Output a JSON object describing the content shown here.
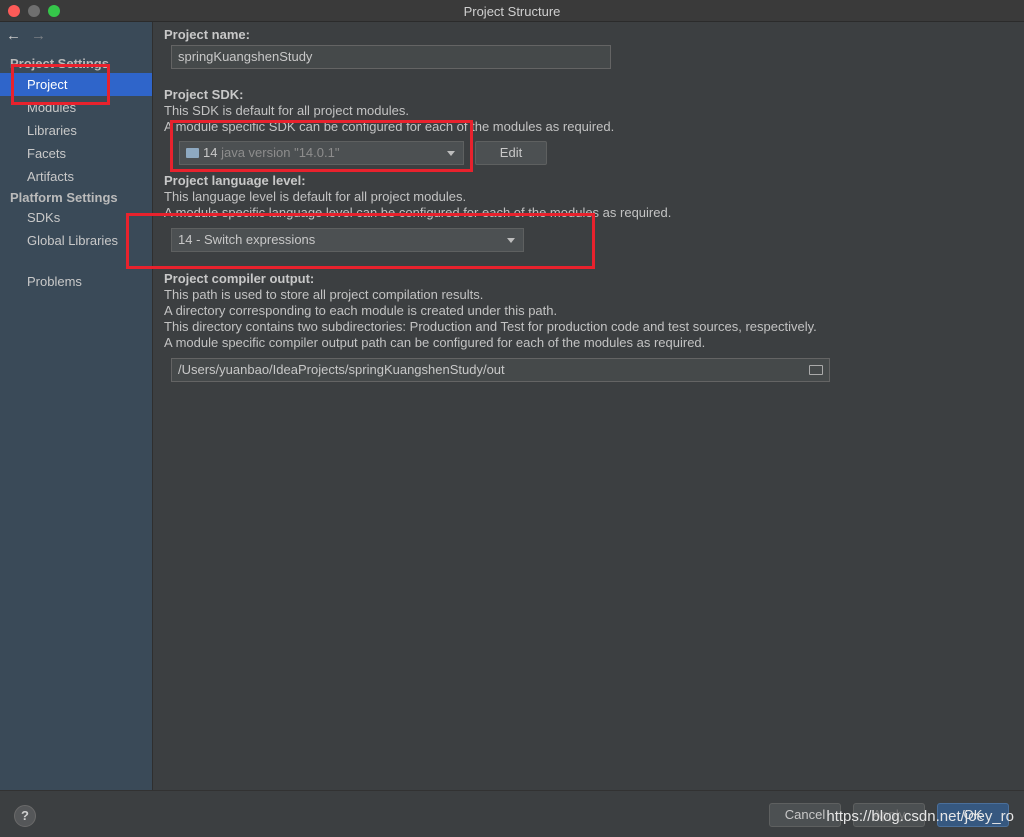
{
  "window": {
    "title": "Project Structure"
  },
  "nav": {
    "back": "←",
    "forward": "→"
  },
  "sidebar": {
    "project_settings_header": "Project Settings",
    "items": [
      {
        "label": "Project"
      },
      {
        "label": "Modules"
      },
      {
        "label": "Libraries"
      },
      {
        "label": "Facets"
      },
      {
        "label": "Artifacts"
      }
    ],
    "platform_settings_header": "Platform Settings",
    "platform_items": [
      {
        "label": "SDKs"
      },
      {
        "label": "Global Libraries"
      }
    ],
    "problems_label": "Problems"
  },
  "project_name": {
    "label": "Project name:",
    "value": "springKuangshenStudy"
  },
  "project_sdk": {
    "label": "Project SDK:",
    "desc1": "This SDK is default for all project modules.",
    "desc2": "A module specific SDK can be configured for each of the modules as required.",
    "selected_version": "14",
    "selected_detail": "java version \"14.0.1\"",
    "edit_label": "Edit"
  },
  "language_level": {
    "label": "Project language level:",
    "desc1": "This language level is default for all project modules.",
    "desc2": "A module specific language level can be configured for each of the modules as required.",
    "selected": "14 - Switch expressions"
  },
  "compiler_output": {
    "label": "Project compiler output:",
    "desc1": "This path is used to store all project compilation results.",
    "desc2": "A directory corresponding to each module is created under this path.",
    "desc3": "This directory contains two subdirectories: Production and Test for production code and test sources, respectively.",
    "desc4": "A module specific compiler output path can be configured for each of the modules as required.",
    "path": "/Users/yuanbao/IdeaProjects/springKuangshenStudy/out"
  },
  "footer": {
    "help": "?",
    "cancel_label": "Cancel",
    "apply_label": "Apply",
    "ok_label": "OK",
    "watermark": "https://blog.csdn.net/joey_ro"
  },
  "colors": {
    "selection": "#2f65ca",
    "annotation_red": "#e8222d"
  }
}
